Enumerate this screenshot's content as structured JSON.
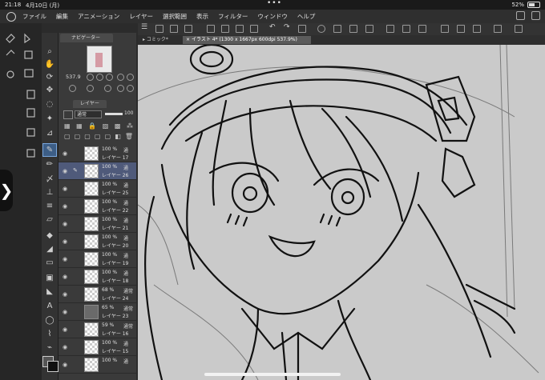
{
  "status": {
    "time": "21:18",
    "date": "4月10日 (月)",
    "battery": "52%"
  },
  "menu": [
    "ファイル",
    "編集",
    "アニメーション",
    "レイヤー",
    "選択範囲",
    "表示",
    "フィルター",
    "ウィンドウ",
    "ヘルプ"
  ],
  "tabs": {
    "comic": "コミック*",
    "illust": "イラスト 4* (1300 x 1667px 600dpi 537.9%)"
  },
  "navigator": {
    "title": "ナビゲーター",
    "zoom": "537.9"
  },
  "layer_panel": {
    "title": "レイヤー",
    "blend_mode": "通常",
    "opacity": "100"
  },
  "layers": [
    {
      "opacity": "100 %",
      "mode": "通",
      "name": "レイヤー 17",
      "selected": false,
      "pen": false
    },
    {
      "opacity": "100 %",
      "mode": "通",
      "name": "レイヤー 26",
      "selected": true,
      "pen": true
    },
    {
      "opacity": "100 %",
      "mode": "通",
      "name": "レイヤー 25",
      "selected": false,
      "pen": false
    },
    {
      "opacity": "100 %",
      "mode": "通",
      "name": "レイヤー 22",
      "selected": false,
      "pen": false
    },
    {
      "opacity": "100 %",
      "mode": "通",
      "name": "レイヤー 21",
      "selected": false,
      "pen": false
    },
    {
      "opacity": "100 %",
      "mode": "通",
      "name": "レイヤー 20",
      "selected": false,
      "pen": false
    },
    {
      "opacity": "100 %",
      "mode": "通",
      "name": "レイヤー 19",
      "selected": false,
      "pen": false
    },
    {
      "opacity": "100 %",
      "mode": "通",
      "name": "レイヤー 18",
      "selected": false,
      "pen": false
    },
    {
      "opacity": "68 %",
      "mode": "通常",
      "name": "レイヤー 24",
      "selected": false,
      "pen": false,
      "dark": false
    },
    {
      "opacity": "65 %",
      "mode": "通常",
      "name": "レイヤー 23",
      "selected": false,
      "pen": false,
      "dark": true
    },
    {
      "opacity": "59 %",
      "mode": "通常",
      "name": "レイヤー 16",
      "selected": false,
      "pen": false
    },
    {
      "opacity": "100 %",
      "mode": "通",
      "name": "レイヤー 15",
      "selected": false,
      "pen": false
    },
    {
      "opacity": "100 %",
      "mode": "通",
      "name": "",
      "selected": false,
      "pen": false
    }
  ],
  "icons": {
    "tools": [
      "zoom-icon",
      "hand-icon",
      "rotate-icon",
      "move-icon",
      "lasso-icon",
      "magic-wand-icon",
      "eyedropper-icon",
      "pen-icon",
      "pencil-icon",
      "brush-icon",
      "airbrush-icon",
      "decoration-icon",
      "eraser-icon",
      "fill-icon",
      "gradient-icon",
      "figure-icon",
      "frame-icon",
      "ruler-icon",
      "text-icon",
      "balloon-icon",
      "line-fix-icon",
      "correction-icon"
    ]
  }
}
